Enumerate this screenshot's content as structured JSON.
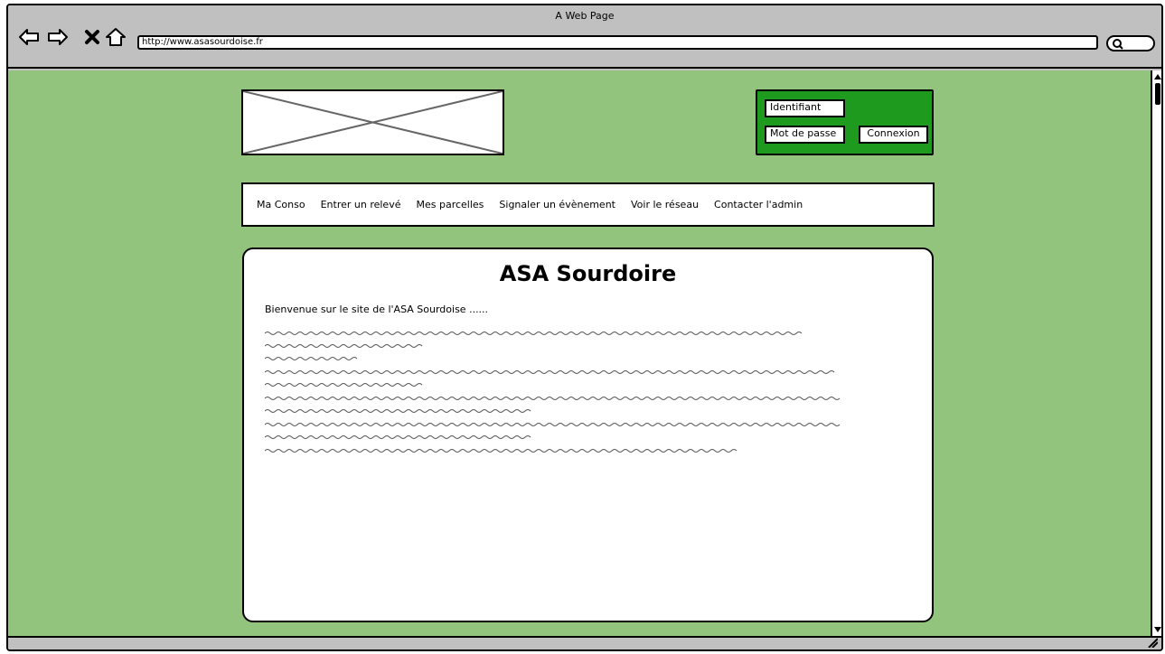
{
  "window": {
    "title": "A Web Page"
  },
  "browser": {
    "url": "http://www.asasourdoise.fr",
    "nav_icons": [
      "back-arrow-icon",
      "forward-arrow-icon",
      "stop-icon",
      "home-icon"
    ],
    "search_icon": "search-icon"
  },
  "header": {
    "logo": "image-placeholder",
    "login": {
      "identifiant_label": "Identifiant",
      "password_label": "Mot de passe",
      "submit_label": "Connexion",
      "background": "#1e9a1e"
    }
  },
  "menu": {
    "items": [
      {
        "label": "Ma Conso"
      },
      {
        "label": "Entrer un relevé"
      },
      {
        "label": "Mes parcelles"
      },
      {
        "label": "Signaler un évènement"
      },
      {
        "label": "Voir le réseau"
      },
      {
        "label": "Contacter l'admin"
      }
    ]
  },
  "content": {
    "title": "ASA Sourdoire",
    "welcome": "Bienvenue sur le site de l'ASA Sourdoise ......"
  },
  "colors": {
    "page_background": "#93c47d",
    "chrome": "#c0c0c0"
  }
}
